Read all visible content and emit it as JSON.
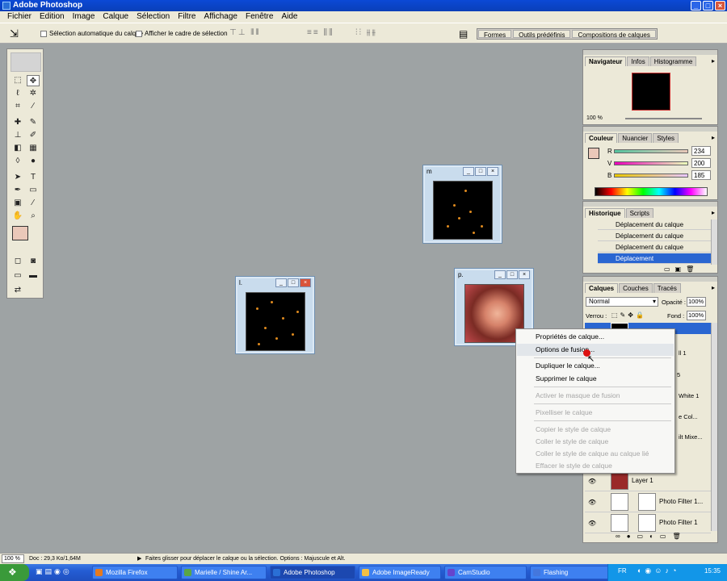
{
  "app": {
    "title": "Adobe Photoshop"
  },
  "menu": [
    "Fichier",
    "Edition",
    "Image",
    "Calque",
    "Sélection",
    "Filtre",
    "Affichage",
    "Fenêtre",
    "Aide"
  ],
  "options": {
    "auto_select_label": "Sélection automatique du calque",
    "bounding_box_label": "Afficher le cadre de sélection",
    "well_tabs": [
      "Formes",
      "Outils prédéfinis",
      "Compositions de calques"
    ]
  },
  "documents": [
    {
      "title": "l."
    },
    {
      "title": "m"
    },
    {
      "title": "p."
    }
  ],
  "navigator": {
    "tabs": [
      "Navigateur",
      "Infos",
      "Histogramme"
    ],
    "zoom": "100 %"
  },
  "color": {
    "tabs": [
      "Couleur",
      "Nuancier",
      "Styles"
    ],
    "channels": [
      {
        "label": "R",
        "value": "234",
        "level": 0.92
      },
      {
        "label": "V",
        "value": "200",
        "level": 0.78
      },
      {
        "label": "B",
        "value": "185",
        "level": 0.73
      }
    ],
    "fg_color": "#eac8b9"
  },
  "history": {
    "tabs": [
      "Historique",
      "Scripts"
    ],
    "rows": [
      "Déplacement du calque",
      "Déplacement du calque",
      "Déplacement du calque",
      "Déplacement"
    ]
  },
  "layers": {
    "tabs": [
      "Calques",
      "Couches",
      "Tracés"
    ],
    "blend_mode": "Normal",
    "opacity_label": "Opacité :",
    "opacity_value": "100%",
    "lock_label": "Verrou :",
    "fill_label": "Fond :",
    "fill_value": "100%",
    "partial_names": [
      "ll 1",
      "5",
      "White 1",
      "e Col...",
      "ilt Mixe..."
    ],
    "rows": [
      "Layer 1",
      "Photo Filter 1...",
      "Photo Filter 1"
    ]
  },
  "context_menu": {
    "items": [
      {
        "label": "Propriétés de calque...",
        "enabled": true
      },
      {
        "label": "Options de fusion...",
        "enabled": true
      },
      {
        "label": "Dupliquer le calque...",
        "enabled": true
      },
      {
        "label": "Supprimer le calque",
        "enabled": true
      },
      {
        "label": "Activer le masque de fusion",
        "enabled": false
      },
      {
        "label": "Pixelliser le calque",
        "enabled": false
      },
      {
        "label": "Copier le style de calque",
        "enabled": false
      },
      {
        "label": "Coller le style de calque",
        "enabled": false
      },
      {
        "label": "Coller le style de calque au calque lié",
        "enabled": false
      },
      {
        "label": "Effacer le style de calque",
        "enabled": false
      }
    ]
  },
  "status": {
    "zoom": "100 %",
    "doc": "Doc : 29,3 Ko/1,64M",
    "hint": "Faites glisser pour déplacer le calque ou la sélection. Options : Majuscule et Alt."
  },
  "taskbar": {
    "tasks": [
      "Mozilla Firefox",
      "Marielle / Shine Ar...",
      "Adobe Photoshop",
      "Adobe ImageReady",
      "CamStudio",
      "Flashing"
    ],
    "lang": "FR",
    "clock": "15:35"
  }
}
